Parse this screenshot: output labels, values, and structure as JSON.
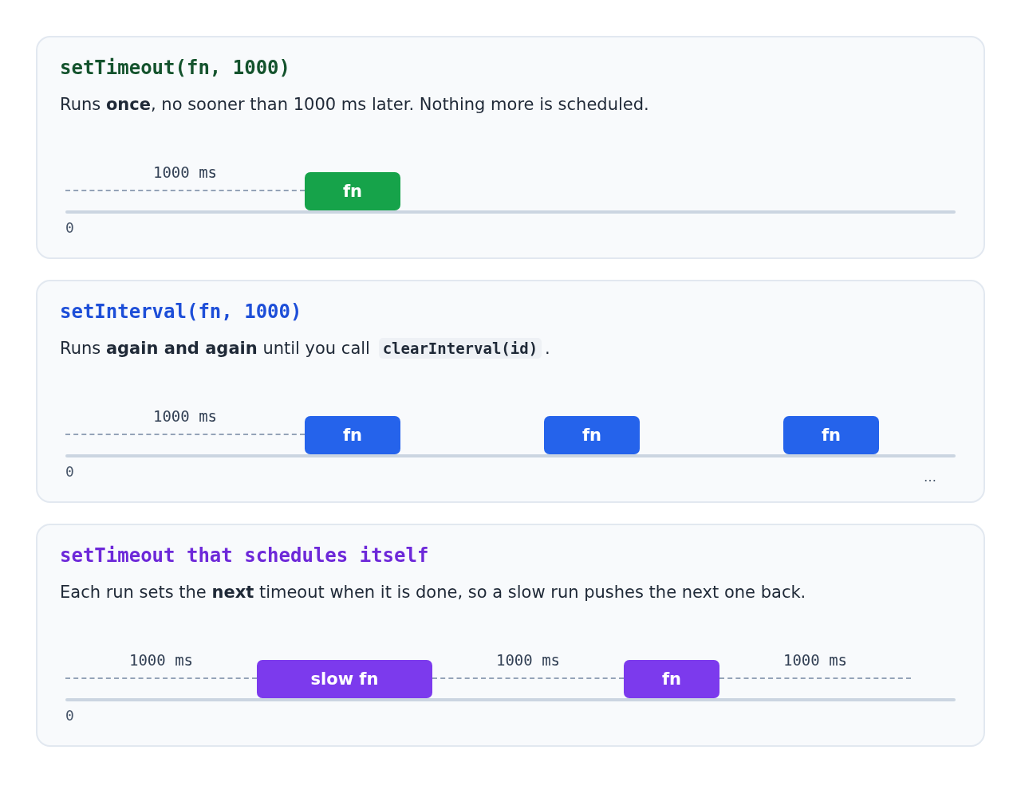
{
  "cards": [
    {
      "kind": "timeout",
      "color": "#16a34a",
      "title": "setTimeout(fn, 1000)",
      "description": [
        {
          "kind": "text",
          "text": "Runs **once**, no sooner than 1000 ms later. Nothing more is scheduled."
        }
      ],
      "segments": [
        {
          "kind": "wait",
          "label": "1000 ms"
        },
        {
          "kind": "run",
          "label": "fn"
        }
      ],
      "origin": "0"
    },
    {
      "kind": "interval",
      "color": "#2563eb",
      "title": "setInterval(fn, 1000)",
      "description": [
        {
          "kind": "text",
          "text": "Runs **again and again** until you call "
        },
        {
          "kind": "code",
          "text": "clearInterval(id)"
        },
        {
          "kind": "text",
          "text": "."
        }
      ],
      "segments": [
        {
          "kind": "wait",
          "label": "1000 ms"
        },
        {
          "kind": "run",
          "label": "fn"
        },
        {
          "kind": "idle"
        },
        {
          "kind": "run",
          "label": "fn"
        },
        {
          "kind": "idle"
        },
        {
          "kind": "run",
          "label": "fn"
        }
      ],
      "origin": "0",
      "end_mark": "…"
    },
    {
      "kind": "recursive",
      "color": "#7c3aed",
      "title": "setTimeout that schedules itself",
      "description": [
        {
          "kind": "text",
          "text": "Each run sets the **next** timeout when it is done, so a slow run pushes the next one back."
        }
      ],
      "segments": [
        {
          "kind": "wait",
          "label": "1000 ms"
        },
        {
          "kind": "slow-run",
          "label": "slow fn"
        },
        {
          "kind": "wait",
          "label": "1000 ms"
        },
        {
          "kind": "run",
          "label": "fn"
        },
        {
          "kind": "wait",
          "label": "1000 ms"
        }
      ],
      "origin": "0"
    }
  ]
}
